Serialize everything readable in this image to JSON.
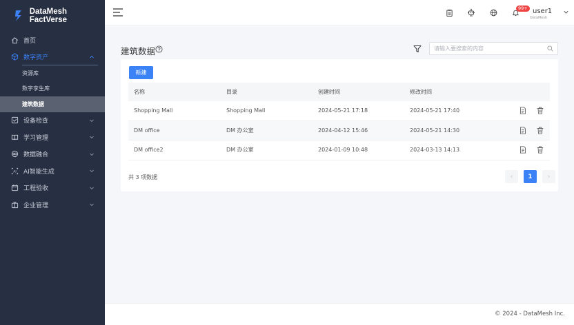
{
  "brand": {
    "name": "DataMesh FactVerse"
  },
  "sidebar": {
    "items": [
      {
        "label": "首页",
        "icon": "home-icon"
      },
      {
        "label": "数字资产",
        "icon": "cube-icon",
        "expanded": true,
        "children": [
          {
            "label": "资源库"
          },
          {
            "label": "数字孪生库"
          },
          {
            "label": "建筑数据",
            "selected": true
          }
        ]
      },
      {
        "label": "设备检查",
        "icon": "checkbox-icon"
      },
      {
        "label": "学习管理",
        "icon": "book-icon"
      },
      {
        "label": "数据融合",
        "icon": "data-fusion-icon"
      },
      {
        "label": "AI智能生成",
        "icon": "ai-icon"
      },
      {
        "label": "工程验收",
        "icon": "calendar-icon"
      },
      {
        "label": "企业管理",
        "icon": "briefcase-icon"
      }
    ]
  },
  "header": {
    "badge": "99+",
    "user": {
      "name": "user1",
      "org": "DataMesh"
    }
  },
  "main": {
    "title": "建筑数据",
    "search_placeholder": "请输入要搜索的内容",
    "new_button": "新建",
    "columns": [
      "名称",
      "目录",
      "创建时间",
      "修改时间"
    ],
    "rows": [
      {
        "name": "Shopping Mall",
        "dir": "Shopping Mall",
        "created": "2024-05-21 17:18",
        "modified": "2024-05-21 17:40"
      },
      {
        "name": "DM office",
        "dir": "DM 办公室",
        "created": "2024-04-12 15:46",
        "modified": "2024-05-21 14:30"
      },
      {
        "name": "DM office2",
        "dir": "DM 办公室",
        "created": "2024-01-09 10:48",
        "modified": "2024-03-13 14:13"
      }
    ],
    "total": "共 3 项数据",
    "pagination": {
      "current": "1",
      "prev": "‹",
      "next": "›"
    }
  },
  "footer": {
    "text": "© 2024 - DataMesh Inc."
  },
  "colors": {
    "accent": "#3b82f6",
    "sidebar_bg": "#272f42",
    "badge": "#ef4444"
  }
}
